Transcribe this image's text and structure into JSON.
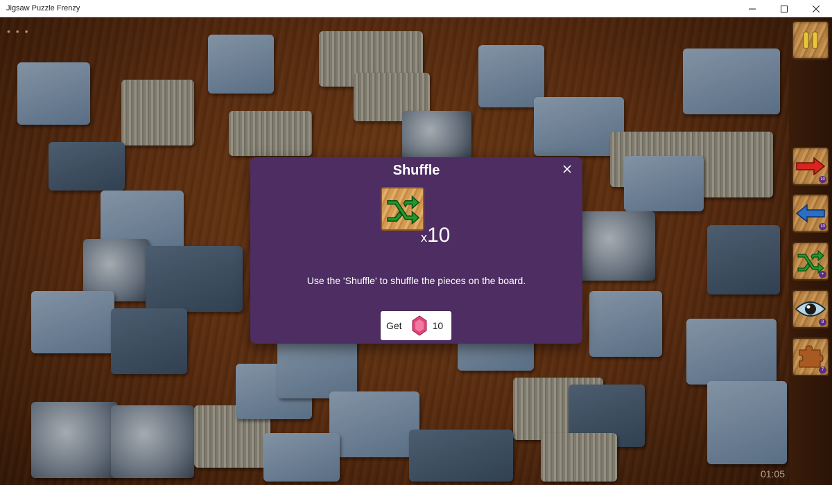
{
  "window": {
    "title": "Jigsaw Puzzle Frenzy",
    "controls": {
      "minimize": "—",
      "maximize": "☐",
      "close": "✕"
    }
  },
  "board": {
    "menu_dots": "• • •",
    "timer": "01:05"
  },
  "sidebar": {
    "pause": {
      "icon": "pause-icon"
    },
    "tools": [
      {
        "name": "next-arrow",
        "icon": "right-arrow-icon",
        "color": "#d8261f",
        "count": "10"
      },
      {
        "name": "prev-arrow",
        "icon": "left-arrow-icon",
        "color": "#2a6fc4",
        "count": "10"
      },
      {
        "name": "shuffle",
        "icon": "shuffle-icon",
        "color": "#1f9a2f",
        "count": "+"
      },
      {
        "name": "preview",
        "icon": "eye-icon",
        "color": "#6aa0b8",
        "count": "8"
      },
      {
        "name": "edge-pieces",
        "icon": "puzzle-piece-icon",
        "color": "#a85a22",
        "count": "7"
      }
    ]
  },
  "dialog": {
    "title": "Shuffle",
    "icon": "shuffle-icon",
    "count_prefix": "x",
    "count": "10",
    "description": "Use the 'Shuffle' to shuffle the pieces on the board.",
    "get_button": {
      "label": "Get",
      "icon": "gem-icon",
      "cost": "10"
    },
    "colors": {
      "background": "#4d2d62",
      "gem": "#e0457b"
    }
  }
}
